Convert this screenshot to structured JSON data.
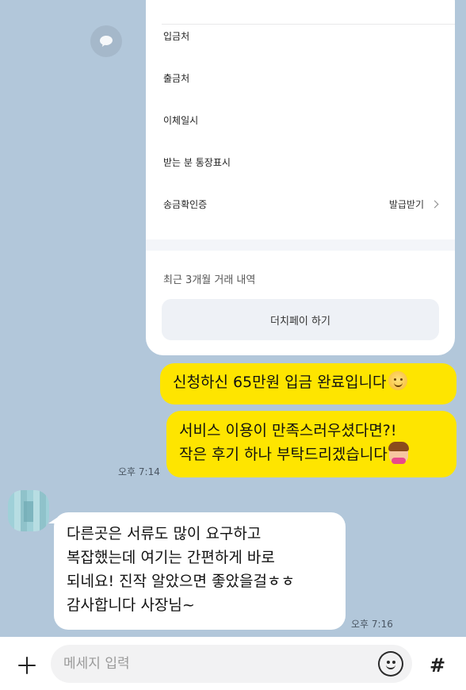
{
  "receipt": {
    "rows": [
      {
        "label": "입금처"
      },
      {
        "label": "출금처"
      },
      {
        "label": "이체일시"
      },
      {
        "label": "받는 분 통장표시"
      },
      {
        "label": "송금확인증",
        "action": "발급받기"
      }
    ],
    "recent_label": "최근 3개월 거래 내역",
    "dutch_button": "더치페이 하기"
  },
  "sent_messages": [
    {
      "text": "신청하신 65만원 입금 완료입니다"
    },
    {
      "lines": [
        "서비스 이용이 만족스러우셨다면?!",
        "작은 후기 하나 부탁드리겠습니다"
      ]
    }
  ],
  "sent_time": "오후 7:14",
  "received_message": {
    "lines": [
      "다른곳은 서류도 많이 요구하고",
      "복잡했는데 여기는 간편하게 바로",
      "되네요! 진작 알았으면 좋았을걸ㅎㅎ",
      "감사합니다 사장님~"
    ],
    "time": "오후 7:16"
  },
  "input": {
    "placeholder": "메세지 입력",
    "hash": "#"
  },
  "colors": {
    "background": "#b2c7da",
    "sent_bubble": "#fee500",
    "received_bubble": "#ffffff"
  }
}
